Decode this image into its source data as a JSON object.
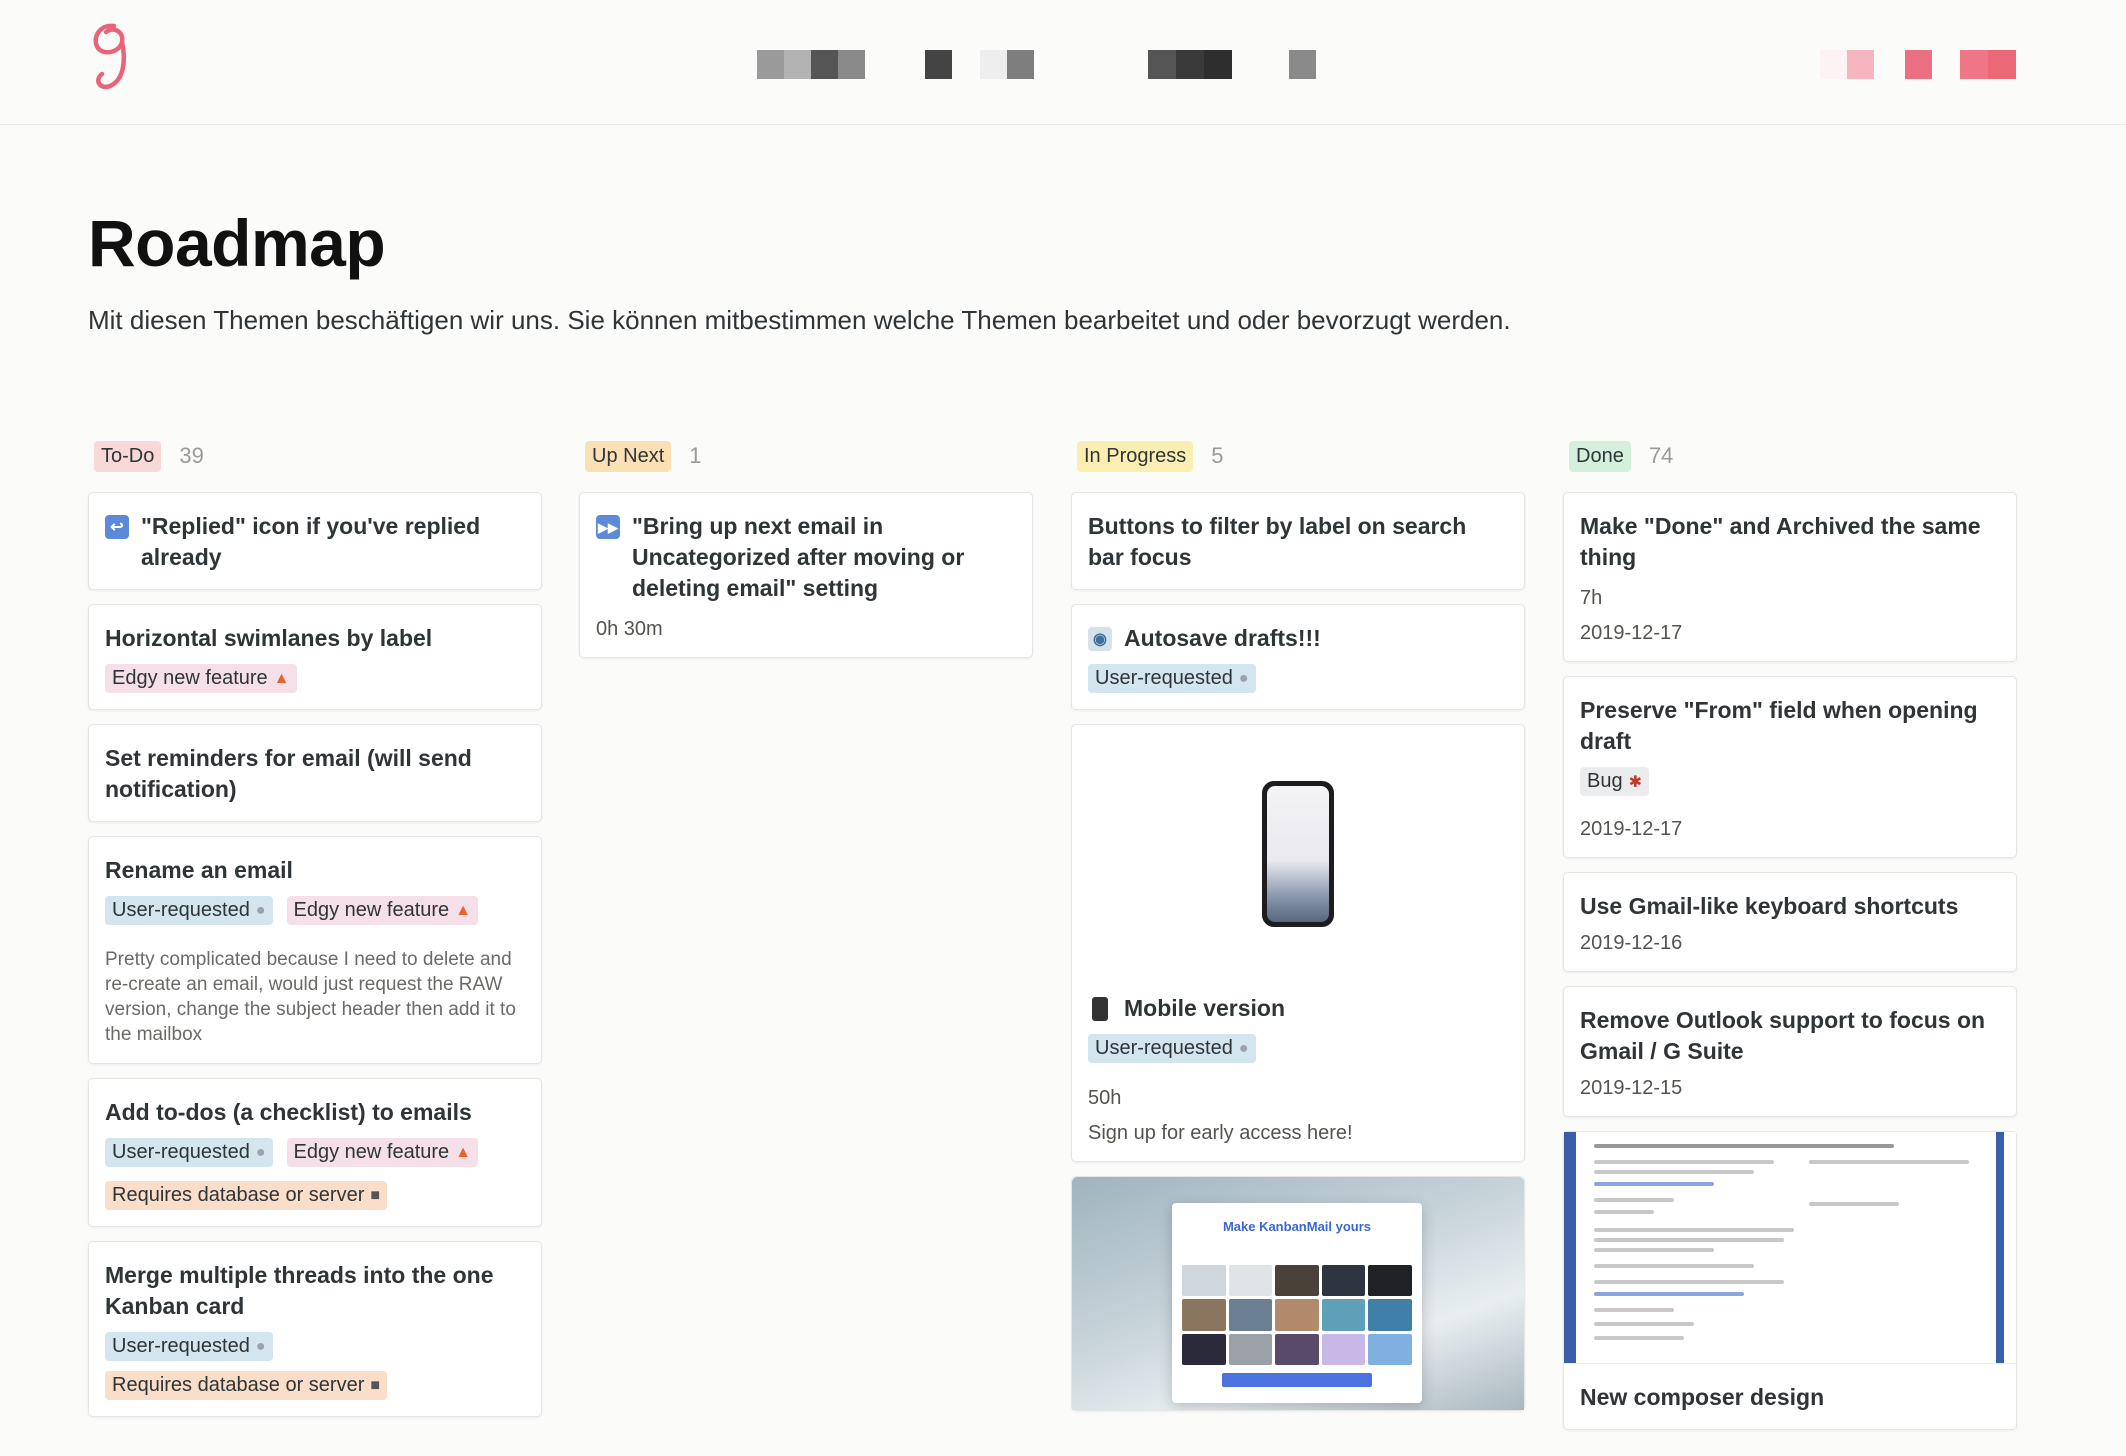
{
  "page": {
    "title": "Roadmap",
    "subtitle": "Mit diesen Themen beschäftigen wir uns. Sie können mitbestimmen welche Themen bearbeitet und oder bevorzugt werden."
  },
  "colors": {
    "accent": "#e9647a",
    "todo": "#f9d9d7",
    "upnext": "#fbe0b5",
    "inprogress": "#fbeeb3",
    "done": "#d4f0dc"
  },
  "columns": [
    {
      "label": "To-Do",
      "count": "39",
      "cards": [
        {
          "icon": "reply-icon",
          "title": "\"Replied\" icon if you've replied already"
        },
        {
          "title": "Horizontal swimlanes by label",
          "tags": [
            "Edgy new feature"
          ]
        },
        {
          "title": "Set reminders for email (will send notification)"
        },
        {
          "title": "Rename an email",
          "tags": [
            "User-requested",
            "Edgy new feature"
          ],
          "desc": "Pretty complicated because I need to delete and re-create an email, would just request the RAW version, change the subject header then add it to the mailbox"
        },
        {
          "title": "Add to-dos (a checklist) to emails",
          "tags": [
            "User-requested",
            "Edgy new feature",
            "Requires database or server"
          ]
        },
        {
          "title": "Merge multiple threads into the one Kanban card",
          "tags": [
            "User-requested",
            "Requires database or server"
          ]
        }
      ]
    },
    {
      "label": "Up Next",
      "count": "1",
      "cards": [
        {
          "icon": "fast-forward-icon",
          "title": "\"Bring up next email in Uncategorized after moving or deleting email\" setting",
          "meta": "0h 30m"
        }
      ]
    },
    {
      "label": "In Progress",
      "count": "5",
      "cards": [
        {
          "title": "Buttons to filter by label on search bar focus"
        },
        {
          "icon": "robot-icon",
          "title": "Autosave drafts!!!",
          "tags": [
            "User-requested"
          ]
        },
        {
          "icon": "mobile-phone-icon",
          "title": "Mobile version",
          "tags": [
            "User-requested"
          ],
          "meta": "50h",
          "meta2": "Sign up for early access here!"
        },
        {
          "cover_text": "Make KanbanMail yours"
        }
      ]
    },
    {
      "label": "Done",
      "count": "74",
      "cards": [
        {
          "title": "Make \"Done\" and Archived the same thing",
          "meta": "7h",
          "meta2": "2019-12-17"
        },
        {
          "title": "Preserve \"From\" field when opening draft",
          "tags": [
            "Bug"
          ],
          "meta": "2019-12-17"
        },
        {
          "title": "Use Gmail-like keyboard shortcuts",
          "meta": "2019-12-16"
        },
        {
          "title": "Remove Outlook support to focus on Gmail / G Suite",
          "meta": "2019-12-15"
        },
        {
          "title": "New composer design"
        }
      ]
    }
  ]
}
